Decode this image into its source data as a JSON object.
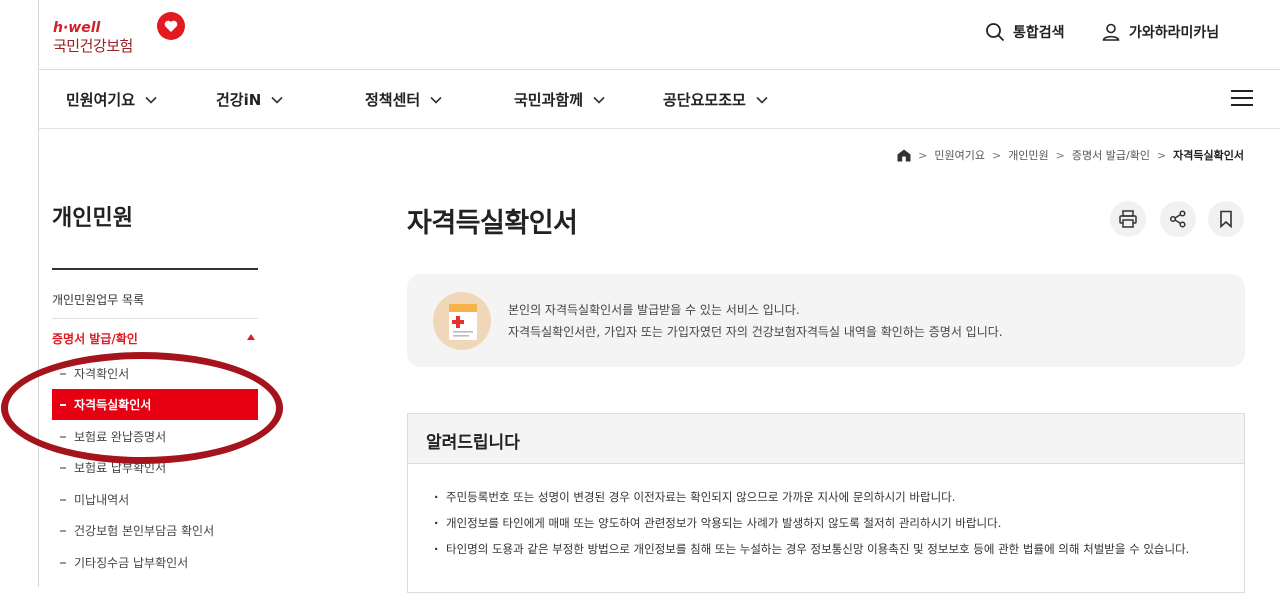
{
  "header": {
    "logo_top": "h·well",
    "logo_name": "국민건강보험",
    "search_label": "통합검색",
    "user_label": "가와하라미카님"
  },
  "gnb": {
    "items": [
      {
        "label": "민원여기요"
      },
      {
        "label": "건강iN"
      },
      {
        "label": "정책센터"
      },
      {
        "label": "국민과함께"
      },
      {
        "label": "공단요모조모"
      }
    ]
  },
  "breadcrumb": {
    "items": [
      "민원여기요",
      "개인민원",
      "증명서 발급/확인",
      "자격득실확인서"
    ]
  },
  "sidebar": {
    "title": "개인민원",
    "top_item": "개인민원업무 목록",
    "active_group": "증명서 발급/확인",
    "sub_items": [
      {
        "label": "자격확인서"
      },
      {
        "label": "자격득실확인서"
      },
      {
        "label": "보험료 완납증명서"
      },
      {
        "label": "보험료 납부확인서"
      },
      {
        "label": "미납내역서"
      },
      {
        "label": "건강보험 본인부담금 확인서"
      },
      {
        "label": "기타징수금 납부확인서"
      }
    ]
  },
  "main": {
    "title": "자격득실확인서",
    "intro_line1": "본인의 자격득실확인서를 발급받을 수 있는 서비스 입니다.",
    "intro_line2": "자격득실확인서란, 가입자 또는 가입자였던 자의 건강보험자격득실 내역을 확인하는 증명서 입니다.",
    "notice_title": "알려드립니다",
    "notice_items": [
      "주민등록번호 또는 성명이 변경된 경우 이전자료는 확인되지 않으므로 가까운 지사에 문의하시기 바랍니다.",
      "개인정보를 타인에게 매매 또는 양도하여 관련정보가 악용되는 사례가 발생하지 않도록 철저히 관리하시기 바랍니다.",
      "타인명의 도용과 같은 부정한 방법으로 개인정보를 침해 또는 누설하는 경우 정보통신망 이용촉진 및 정보보호 등에 관한 법률에 의해 처벌받을 수 있습니다."
    ]
  },
  "colors": {
    "brand_red": "#e60012",
    "annotation_ring": "#a5141c"
  },
  "icons": [
    "heart-logo-icon",
    "search-icon",
    "user-icon",
    "chevron-down-icon",
    "hamburger-menu-icon",
    "home-icon",
    "print-icon",
    "share-icon",
    "bookmark-icon",
    "document-icon"
  ]
}
